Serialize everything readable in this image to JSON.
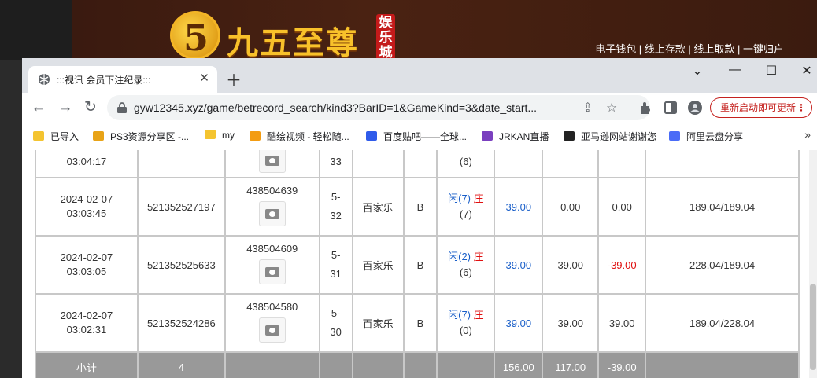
{
  "site": {
    "logo_digit": "5",
    "logo_text": "九五至尊",
    "logo_badge": "娱乐城",
    "nav_links": "电子钱包 | 线上存款 | 线上取款 | 一键归户"
  },
  "browser": {
    "tab_title": ":::视讯 会员下注纪录:::",
    "url": "gyw12345.xyz/game/betrecord_search/kind3?BarID=1&GameKind=3&date_start...",
    "relaunch_label": "重新启动即可更新",
    "bookmarks": [
      {
        "label": "已导入",
        "color": "#f4c430"
      },
      {
        "label": "PS3资源分享区 -...",
        "color": "#e8a317"
      },
      {
        "label": "my",
        "color": "#f4c430"
      },
      {
        "label": "酷绘视频 - 轻松随...",
        "color": "#f39c12"
      },
      {
        "label": "百度贴吧——全球...",
        "color": "#2f5bea"
      },
      {
        "label": "JRKAN直播",
        "color": "#7a3fbf"
      },
      {
        "label": "亚马逊网站谢谢您",
        "color": "#222222"
      },
      {
        "label": "阿里云盘分享",
        "color": "#4a6cf7"
      }
    ]
  },
  "table": {
    "partial_row": {
      "time": "03:04:17",
      "game_no": "33"
    },
    "rows": [
      {
        "date": "2024-02-07",
        "time": "03:03:45",
        "order_id": "521352527197",
        "game_no": "438504639",
        "ju_a": "5-",
        "ju_b": "32",
        "type": "百家乐",
        "table": "B",
        "res_a": "闲(7)",
        "res_b": "庄",
        "res_c": "(7)",
        "bet": "39.00",
        "valid": "0.00",
        "win": "0.00",
        "balance": "189.04/189.04",
        "win_color": "normal"
      },
      {
        "date": "2024-02-07",
        "time": "03:03:05",
        "order_id": "521352525633",
        "game_no": "438504609",
        "ju_a": "5-",
        "ju_b": "31",
        "type": "百家乐",
        "table": "B",
        "res_a": "闲(2)",
        "res_b": "庄",
        "res_c": "(6)",
        "bet": "39.00",
        "valid": "39.00",
        "win": "-39.00",
        "balance": "228.04/189.04",
        "win_color": "red"
      },
      {
        "date": "2024-02-07",
        "time": "03:02:31",
        "order_id": "521352524286",
        "game_no": "438504580",
        "ju_a": "5-",
        "ju_b": "30",
        "type": "百家乐",
        "table": "B",
        "res_a": "闲(7)",
        "res_b": "庄",
        "res_c": "(0)",
        "bet": "39.00",
        "valid": "39.00",
        "win": "39.00",
        "balance": "189.04/228.04",
        "win_color": "normal"
      }
    ],
    "subtotal": {
      "label": "小计",
      "count": "4",
      "bet": "156.00",
      "valid": "117.00",
      "win": "-39.00"
    }
  }
}
